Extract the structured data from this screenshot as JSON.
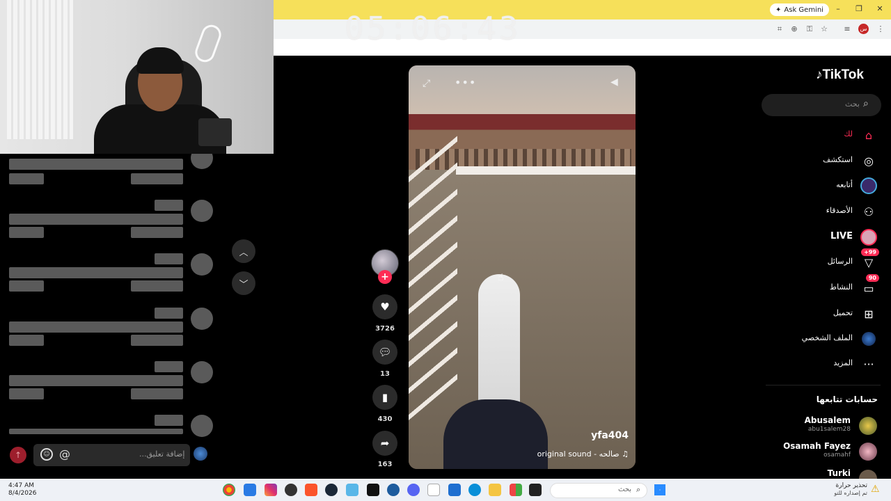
{
  "overlay": {
    "clock": "05:06:43"
  },
  "browser": {
    "ask_gemini": "Ask Gemini",
    "profile_initial": "س"
  },
  "comments": {
    "placeholder": "إضافة تعليق...",
    "mention": "@"
  },
  "video": {
    "username": "yfa404",
    "music": "original sound - صالحه",
    "likes": "3726",
    "comments": "13",
    "saves": "430",
    "shares": "163"
  },
  "sidebar": {
    "logo": "TikTok",
    "search_placeholder": "بحث",
    "items": [
      {
        "label": "لك",
        "icon": "home-icon",
        "active": true
      },
      {
        "label": "استكشف",
        "icon": "compass-icon"
      },
      {
        "label": "أتابعه",
        "icon": "following-icon"
      },
      {
        "label": "الأصدقاء",
        "icon": "friends-icon"
      },
      {
        "label": "LIVE",
        "icon": "live-icon"
      },
      {
        "label": "الرسائل",
        "icon": "messages-icon",
        "badge": "+99"
      },
      {
        "label": "النشاط",
        "icon": "activity-icon",
        "badge": "90"
      },
      {
        "label": "تحميل",
        "icon": "upload-icon"
      },
      {
        "label": "الملف الشخصي",
        "icon": "profile-icon"
      },
      {
        "label": "المزيد",
        "icon": "more-icon"
      }
    ],
    "following_title": "حسابات تتابعها",
    "accounts": [
      {
        "name": "Abusalem",
        "handle": "abu1salem28"
      },
      {
        "name": "Osamah Fayez",
        "handle": "osamahf"
      },
      {
        "name": "Turki",
        "handle": ""
      }
    ]
  },
  "taskbar": {
    "time": "4:47 AM",
    "date": "8/4/2026",
    "search": "بحث",
    "weather_title": "تحذير حرارة",
    "weather_sub": "تم إصداره للتو"
  },
  "colors": {
    "accent": "#fe2c55",
    "chrome_top": "#f6e05a"
  }
}
